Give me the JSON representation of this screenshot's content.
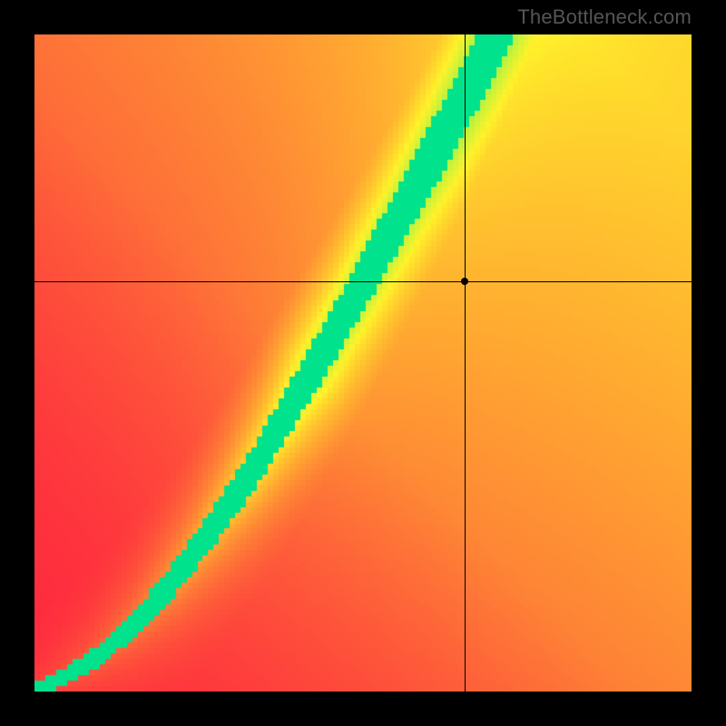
{
  "watermark": "TheBottleneck.com",
  "chart_data": {
    "type": "heatmap",
    "title": "",
    "xlabel": "",
    "ylabel": "",
    "xlim": [
      0,
      1
    ],
    "ylim": [
      0,
      1
    ],
    "crosshair": {
      "x": 0.655,
      "y": 0.625
    },
    "marker": {
      "x": 0.655,
      "y": 0.625
    },
    "ridge": [
      {
        "x": 0.0,
        "y": 0.0
      },
      {
        "x": 0.08,
        "y": 0.04
      },
      {
        "x": 0.15,
        "y": 0.1
      },
      {
        "x": 0.22,
        "y": 0.18
      },
      {
        "x": 0.28,
        "y": 0.26
      },
      {
        "x": 0.34,
        "y": 0.35
      },
      {
        "x": 0.4,
        "y": 0.45
      },
      {
        "x": 0.46,
        "y": 0.55
      },
      {
        "x": 0.52,
        "y": 0.66
      },
      {
        "x": 0.58,
        "y": 0.77
      },
      {
        "x": 0.64,
        "y": 0.88
      },
      {
        "x": 0.7,
        "y": 1.0
      }
    ],
    "ridge_width_start": 0.02,
    "ridge_width_end": 0.12,
    "yellow_halo_scale": 2.2,
    "colorscale": [
      "#fe2a3e",
      "#fe6d38",
      "#ffb030",
      "#fff22a",
      "#9cf246",
      "#00e28c"
    ]
  }
}
